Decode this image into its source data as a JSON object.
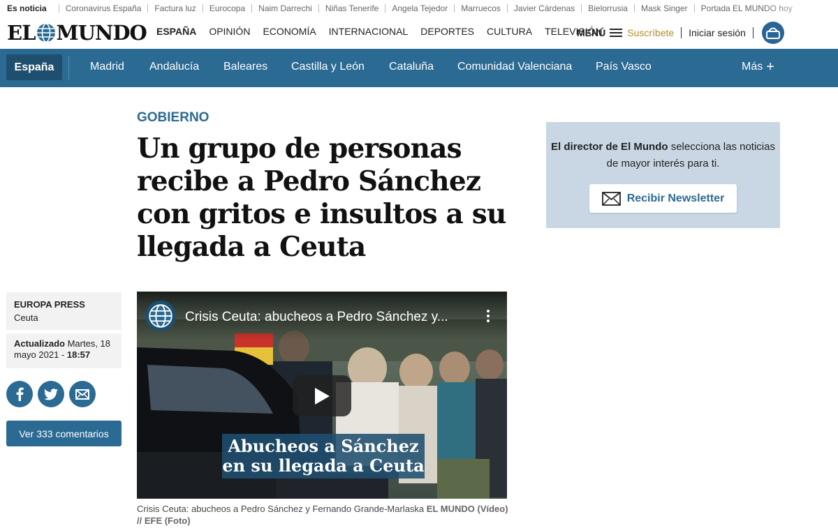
{
  "trending": {
    "lead": "Es noticia",
    "items": [
      "Coronavirus España",
      "Factura luz",
      "Eurocopa",
      "Naim Darrechi",
      "Niñas Tenerife",
      "Angela Tejedor",
      "Marruecos",
      "Javier Cárdenas",
      "Bielorrusia",
      "Mask Singer",
      "Portada EL MUNDO hoy"
    ]
  },
  "header": {
    "logo_left": "EL",
    "logo_right": "MUNDO",
    "nav": [
      "ESPAÑA",
      "OPINIÓN",
      "ECONOMÍA",
      "INTERNACIONAL",
      "DEPORTES",
      "CULTURA",
      "TELEVISIÓN"
    ],
    "menu_label": "MENÚ",
    "subscribe_label": "Suscríbete",
    "login_label": "Iniciar sesión"
  },
  "section_nav": {
    "active": "España",
    "tabs": [
      "Madrid",
      "Andalucía",
      "Baleares",
      "Castilla y León",
      "Cataluña",
      "Comunidad Valenciana",
      "País Vasco"
    ],
    "more_label": "Más"
  },
  "article": {
    "kicker": "GOBIERNO",
    "headline": "Un grupo de personas recibe a Pedro Sánchez con gritos e insultos a su llegada a Ceuta",
    "agency": "EUROPA PRESS",
    "location": "Ceuta",
    "updated_label": "Actualizado",
    "updated_date": "Martes, 18 mayo 2021",
    "updated_sep": " - ",
    "updated_time": "18:57",
    "comments_label": "Ver 333 comentarios",
    "share_icons": [
      "facebook-icon",
      "twitter-icon",
      "email-icon"
    ]
  },
  "video": {
    "title": "Crisis Ceuta: abucheos a Pedro Sánchez y...",
    "overlay_line1": "Abucheos a Sánchez",
    "overlay_line2": "en su llegada a Ceuta",
    "caption": "Crisis Ceuta: abucheos a Pedro Sánchez y Fernando Grande-Marlaska",
    "credit": "EL MUNDO (Vídeo) // EFE (Foto)"
  },
  "newsletter": {
    "text_bold": "El director de El Mundo",
    "text_rest": "selecciona las noticias de mayor interés para ti.",
    "button_label": "Recibir Newsletter"
  },
  "colors": {
    "brand_blue": "#2b6a93",
    "nav_active": "#1f4f6f",
    "subscribe_gold": "#b18d2b",
    "newsletter_bg": "#c8d7e3"
  }
}
